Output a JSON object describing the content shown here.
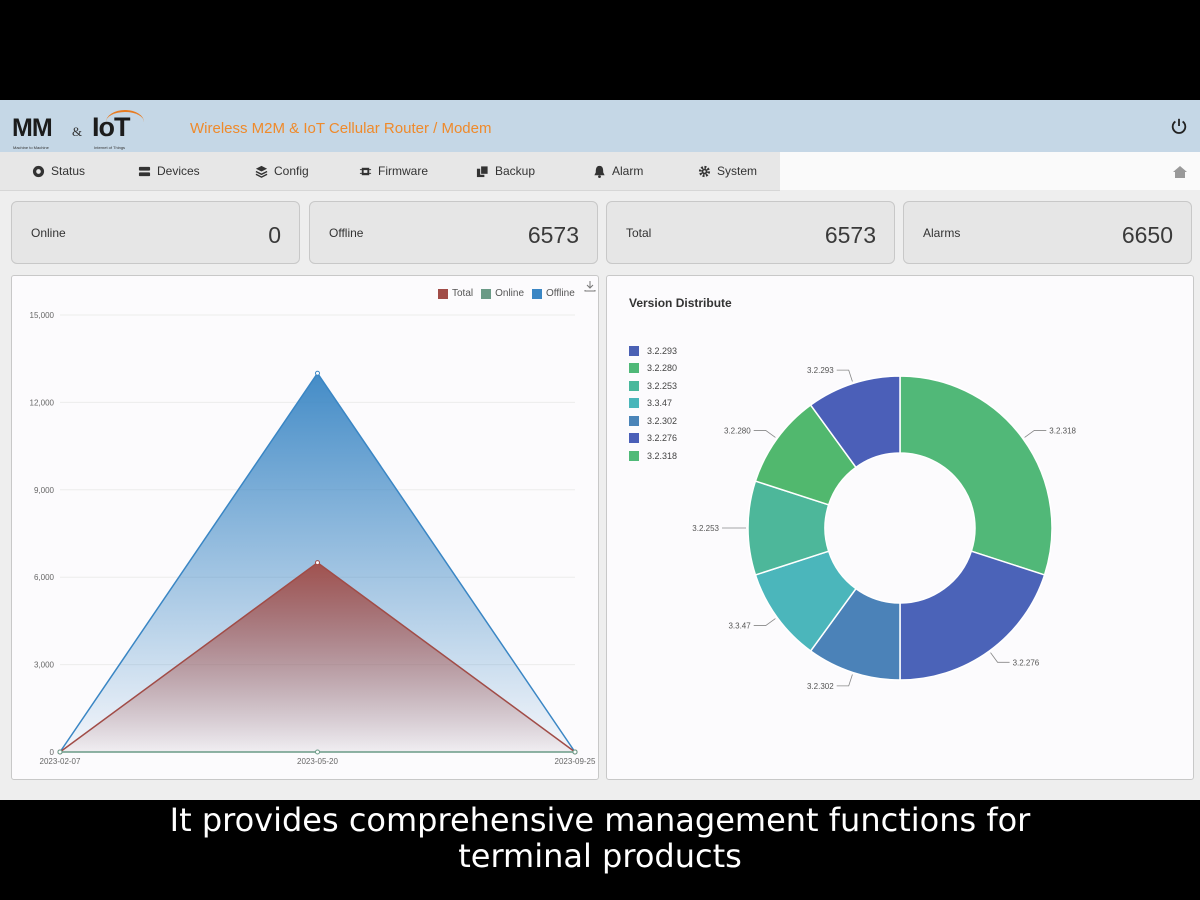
{
  "header": {
    "logo_mm": "MM",
    "logo_amp": "&",
    "logo_iot": "IoT",
    "logo_sub_left": "Machine to Machine",
    "logo_sub_right": "Internet of Things",
    "title": "Wireless M2M & IoT Cellular Router / Modem",
    "power_icon": "power-icon"
  },
  "nav": {
    "items": [
      {
        "label": "Status",
        "icon": "status-icon"
      },
      {
        "label": "Devices",
        "icon": "devices-icon"
      },
      {
        "label": "Config",
        "icon": "config-icon"
      },
      {
        "label": "Firmware",
        "icon": "firmware-icon"
      },
      {
        "label": "Backup",
        "icon": "backup-icon"
      },
      {
        "label": "Alarm",
        "icon": "bell-icon"
      },
      {
        "label": "System",
        "icon": "gear-icon"
      }
    ],
    "home_icon": "home-icon"
  },
  "cards": [
    {
      "label": "Online",
      "value": "0"
    },
    {
      "label": "Offline",
      "value": "6573"
    },
    {
      "label": "Total",
      "value": "6573"
    },
    {
      "label": "Alarms",
      "value": "6650"
    }
  ],
  "colors": {
    "total": "#a14c47",
    "online": "#6a9a86",
    "offline": "#3a86c4",
    "header_bg": "#c5d7e6",
    "title_orange": "#ef8a2b"
  },
  "chart_data": [
    {
      "type": "area",
      "x": [
        "2023-02-07",
        "2023-05-20",
        "2023-09-25"
      ],
      "series": [
        {
          "name": "Total",
          "values": [
            0,
            6500,
            0
          ]
        },
        {
          "name": "Online",
          "values": [
            0,
            0,
            0
          ]
        },
        {
          "name": "Offline",
          "values": [
            0,
            13000,
            0
          ]
        }
      ],
      "yticks": [
        "0",
        "3,000",
        "6,000",
        "9,000",
        "12,000",
        "15,000"
      ],
      "ylim": [
        0,
        15000
      ],
      "legend": "top-right",
      "grid": true,
      "download_icon": "download-icon"
    },
    {
      "type": "pie",
      "title": "Version Distribute",
      "legend_items": [
        "3.2.293",
        "3.2.280",
        "3.2.253",
        "3.3.47",
        "3.2.302",
        "3.2.276",
        "3.2.318"
      ],
      "legend_colors": [
        "#4a60b4",
        "#4fb878",
        "#48b89c",
        "#49b6ba",
        "#4a84b8",
        "#4a5fb8",
        "#4fba78"
      ],
      "slices": [
        {
          "label": "3.2.318",
          "value": 30,
          "color": "#51b878"
        },
        {
          "label": "3.2.276",
          "value": 20,
          "color": "#4b63b8"
        },
        {
          "label": "3.2.302",
          "value": 10,
          "color": "#4b82b8"
        },
        {
          "label": "3.3.47",
          "value": 10,
          "color": "#4bb6bb"
        },
        {
          "label": "3.2.253",
          "value": 10,
          "color": "#4db79a"
        },
        {
          "label": "3.2.280",
          "value": 10,
          "color": "#51b86e"
        },
        {
          "label": "3.2.293",
          "value": 10,
          "color": "#4b5fb8"
        }
      ],
      "legend": "left"
    }
  ],
  "caption": {
    "line1": "It provides comprehensive management functions for",
    "line2": "terminal products"
  }
}
